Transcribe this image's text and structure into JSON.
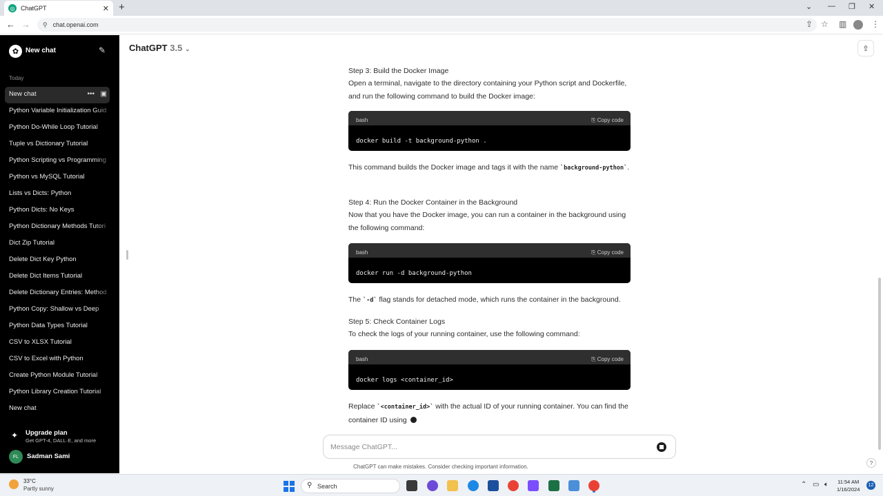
{
  "browser": {
    "tab_title": "ChatGPT",
    "url": "chat.openai.com"
  },
  "sidebar": {
    "new_chat_label": "New chat",
    "section_today": "Today",
    "items": [
      {
        "label": "New chat"
      },
      {
        "label": "Python Variable Initialization Guid"
      },
      {
        "label": "Python Do-While Loop Tutorial"
      },
      {
        "label": "Tuple vs Dictionary Tutorial"
      },
      {
        "label": "Python Scripting vs Programming"
      },
      {
        "label": "Python vs MySQL Tutorial"
      },
      {
        "label": "Lists vs Dicts: Python"
      },
      {
        "label": "Python Dicts: No Keys"
      },
      {
        "label": "Python Dictionary Methods Tutori"
      },
      {
        "label": "Dict Zip Tutorial"
      },
      {
        "label": "Delete Dict Key Python"
      },
      {
        "label": "Delete Dict Items Tutorial"
      },
      {
        "label": "Delete Dictionary Entries: Method"
      },
      {
        "label": "Python Copy: Shallow vs Deep"
      },
      {
        "label": "Python Data Types Tutorial"
      },
      {
        "label": "CSV to XLSX Tutorial"
      },
      {
        "label": "CSV to Excel with Python"
      },
      {
        "label": "Create Python Module Tutorial"
      },
      {
        "label": "Python Library Creation Tutorial"
      },
      {
        "label": "New chat"
      }
    ],
    "upgrade_title": "Upgrade plan",
    "upgrade_sub": "Get GPT-4, DALL·E, and more",
    "user_initials": "FL",
    "user_name": "Sadman Sami"
  },
  "header": {
    "model": "ChatGPT",
    "version": "3.5"
  },
  "message": {
    "step3_title": "Step 3: Build the Docker Image",
    "step3_text": "Open a terminal, navigate to the directory containing your Python script and Dockerfile, and run the following command to build the Docker image:",
    "code1_lang": "bash",
    "code1_copy": "Copy code",
    "code1_cmd": "docker build -t background-python .",
    "p2_a": "This command builds the Docker image and tags it with the name ",
    "p2_code": "`background-python`",
    "p2_b": ".",
    "step4_title": "Step 4: Run the Docker Container in the Background",
    "step4_text": "Now that you have the Docker image, you can run a container in the background using the following command:",
    "code2_lang": "bash",
    "code2_copy": "Copy code",
    "code2_cmd": "docker run -d background-python",
    "p3_a": "The ",
    "p3_code": "`-d`",
    "p3_b": " flag stands for detached mode, which runs the container in the background.",
    "step5_title": "Step 5: Check Container Logs",
    "step5_text": "To check the logs of your running container, use the following command:",
    "code3_lang": "bash",
    "code3_copy": "Copy code",
    "code3_cmd": "docker logs <container_id>",
    "p4_a": "Replace ",
    "p4_code": "`<container_id>`",
    "p4_b": " with the actual ID of your running container. You can find the container ID using "
  },
  "composer": {
    "placeholder": "Message ChatGPT..."
  },
  "disclaimer": "ChatGPT can make mistakes. Consider checking important information.",
  "taskbar": {
    "temp": "33°C",
    "condition": "Partly sunny",
    "search_label": "Search",
    "time": "11:54 AM",
    "date": "1/16/2024",
    "notifications": "12"
  }
}
